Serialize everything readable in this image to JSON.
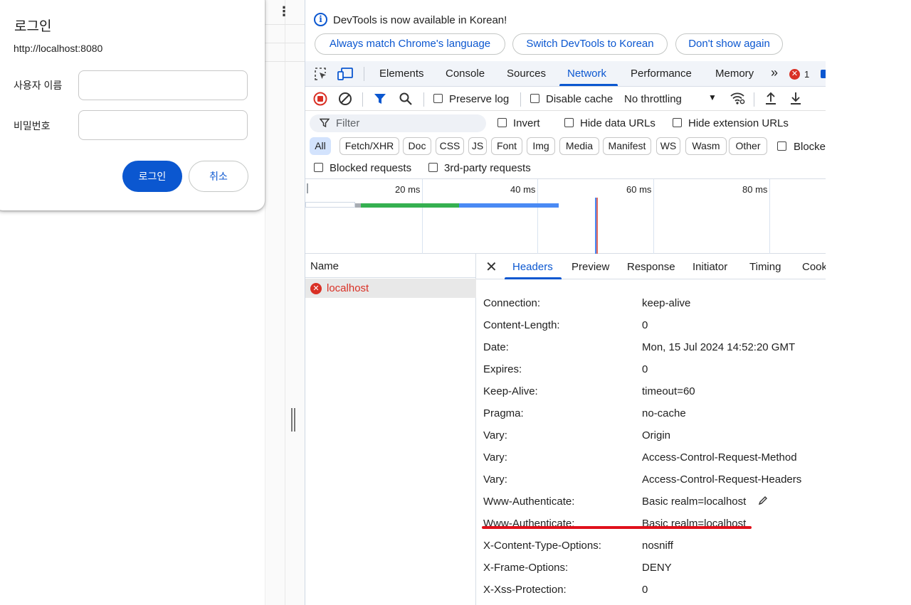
{
  "login": {
    "title": "로그인",
    "origin": "http://localhost:8080",
    "username_label": "사용자 이름",
    "password_label": "비밀번호",
    "username_value": "",
    "password_value": "",
    "ok_label": "로그인",
    "cancel_label": "취소"
  },
  "infobar": {
    "message": "DevTools is now available in Korean!",
    "buttons": [
      "Always match Chrome's language",
      "Switch DevTools to Korean",
      "Don't show again"
    ]
  },
  "tabs": {
    "items": [
      "Elements",
      "Console",
      "Sources",
      "Network",
      "Performance",
      "Memory"
    ],
    "active": "Network",
    "more": "»",
    "error_count": "1"
  },
  "toolbar": {
    "preserve_log": "Preserve log",
    "disable_cache": "Disable cache",
    "throttling": "No throttling"
  },
  "filter": {
    "placeholder": "Filter",
    "invert": "Invert",
    "hide_data_urls": "Hide data URLs",
    "hide_extension_urls": "Hide extension URLs",
    "types": [
      "All",
      "Fetch/XHR",
      "Doc",
      "CSS",
      "JS",
      "Font",
      "Img",
      "Media",
      "Manifest",
      "WS",
      "Wasm",
      "Other"
    ],
    "active_type": "All",
    "blocked_cookies": "Blocke",
    "blocked_requests": "Blocked requests",
    "third_party": "3rd-party requests"
  },
  "overview": {
    "ticks": [
      "20 ms",
      "40 ms",
      "60 ms",
      "80 ms"
    ]
  },
  "requests": {
    "column_name": "Name",
    "items": [
      {
        "name": "localhost",
        "status": "error"
      }
    ]
  },
  "detail": {
    "tabs": [
      "Headers",
      "Preview",
      "Response",
      "Initiator",
      "Timing",
      "Cook"
    ],
    "active": "Headers",
    "headers": [
      {
        "name": "Connection:",
        "value": "keep-alive"
      },
      {
        "name": "Content-Length:",
        "value": "0"
      },
      {
        "name": "Date:",
        "value": "Mon, 15 Jul 2024 14:52:20 GMT"
      },
      {
        "name": "Expires:",
        "value": "0"
      },
      {
        "name": "Keep-Alive:",
        "value": "timeout=60"
      },
      {
        "name": "Pragma:",
        "value": "no-cache"
      },
      {
        "name": "Vary:",
        "value": "Origin"
      },
      {
        "name": "Vary:",
        "value": "Access-Control-Request-Method"
      },
      {
        "name": "Vary:",
        "value": "Access-Control-Request-Headers"
      },
      {
        "name": "Www-Authenticate:",
        "value": "Basic realm=localhost"
      },
      {
        "name": "Www-Authenticate:",
        "value": "Basic realm=localhost"
      },
      {
        "name": "X-Content-Type-Options:",
        "value": "nosniff"
      },
      {
        "name": "X-Frame-Options:",
        "value": "DENY"
      },
      {
        "name": "X-Xss-Protection:",
        "value": "0"
      }
    ]
  },
  "colors": {
    "accent": "#0b57d0",
    "error": "#d93025",
    "highlight_underline": "#e0111b"
  }
}
